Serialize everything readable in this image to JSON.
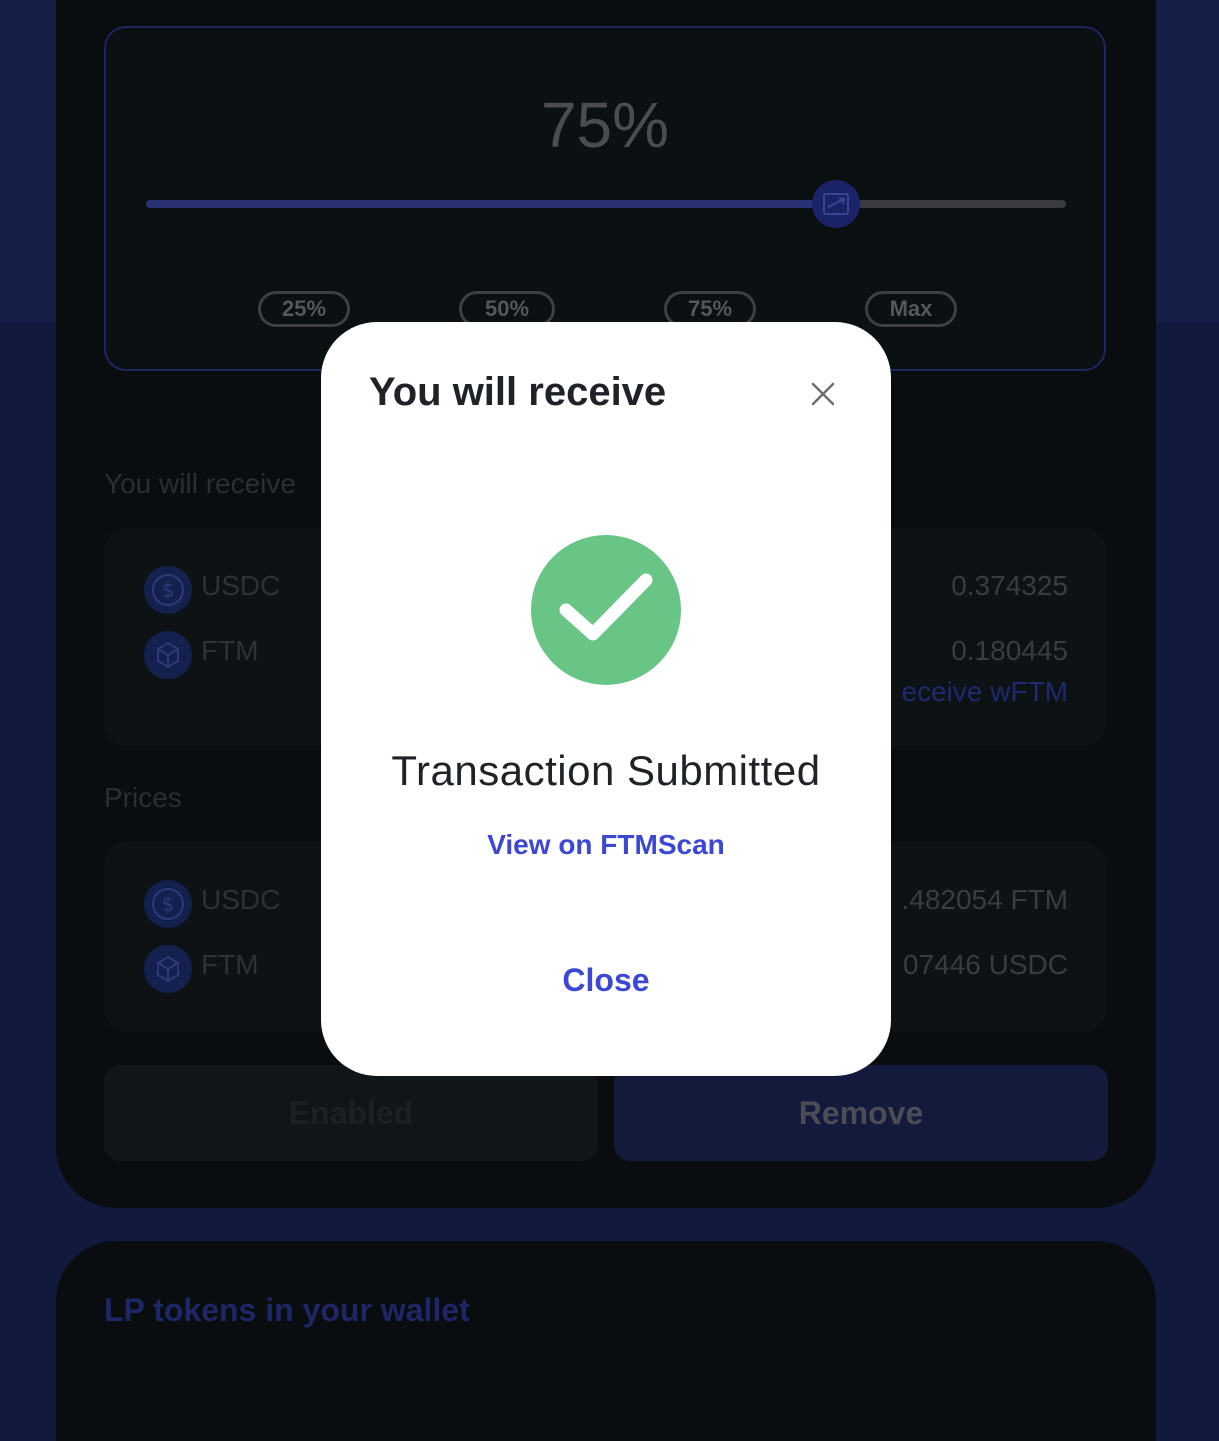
{
  "slider": {
    "percent_label": "75%",
    "value_percent": 75,
    "presets": [
      "25%",
      "50%",
      "75%",
      "Max"
    ]
  },
  "receive_section": {
    "label": "You will receive",
    "tokens": [
      {
        "symbol": "USDC",
        "amount": "0.374325"
      },
      {
        "symbol": "FTM",
        "amount": "0.180445"
      }
    ],
    "receive_link": "eceive wFTM"
  },
  "prices_section": {
    "label": "Prices",
    "rows": [
      {
        "symbol": "USDC",
        "value": ".482054 FTM"
      },
      {
        "symbol": "FTM",
        "value": "07446 USDC"
      }
    ]
  },
  "buttons": {
    "enabled_label": "Enabled",
    "remove_label": "Remove"
  },
  "lp_section": {
    "title": "LP tokens in your wallet"
  },
  "modal": {
    "title": "You will receive",
    "status": "Transaction Submitted",
    "view_link": "View on FTMScan",
    "close_label": "Close"
  },
  "colors": {
    "accent": "#3c47d4",
    "success": "#68c586",
    "background": "#111a3c",
    "card": "#090d0f"
  }
}
